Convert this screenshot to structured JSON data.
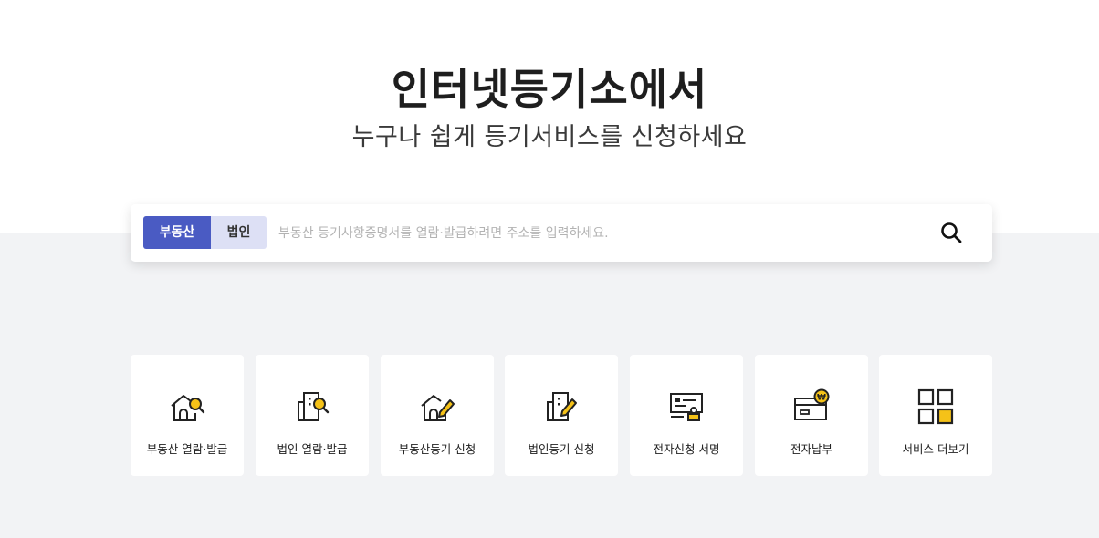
{
  "hero": {
    "title": "인터넷등기소에서",
    "subtitle": "누구나 쉽게 등기서비스를 신청하세요"
  },
  "search": {
    "tabs": [
      {
        "label": "부동산",
        "active": true
      },
      {
        "label": "법인",
        "active": false
      }
    ],
    "placeholder": "부동산 등기사항증명서를 열람·발급하려면 주소를 입력하세요.",
    "value": "",
    "button_icon": "search-icon"
  },
  "services": [
    {
      "label": "부동산 열람·발급",
      "icon": "house-search-icon"
    },
    {
      "label": "법인 열람·발급",
      "icon": "building-search-icon"
    },
    {
      "label": "부동산등기 신청",
      "icon": "house-pen-icon"
    },
    {
      "label": "법인등기 신청",
      "icon": "building-pen-icon"
    },
    {
      "label": "전자신청 서명",
      "icon": "certificate-stamp-icon"
    },
    {
      "label": "전자납부",
      "icon": "card-won-icon"
    },
    {
      "label": "서비스 더보기",
      "icon": "grid-more-icon"
    }
  ],
  "colors": {
    "accent": "#4a5bc3",
    "accent_light": "#dde0f5",
    "highlight": "#f5c218",
    "background": "#f2f3f5"
  }
}
